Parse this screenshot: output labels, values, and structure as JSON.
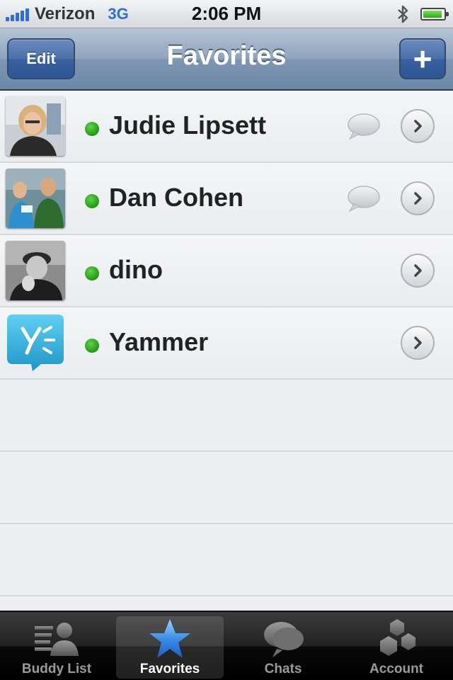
{
  "status_bar": {
    "carrier": "Verizon",
    "network": "3G",
    "time": "2:06 PM"
  },
  "nav": {
    "title": "Favorites",
    "edit_label": "Edit",
    "add_label": "+"
  },
  "contacts": [
    {
      "name": "Judie Lipsett",
      "status": "online",
      "has_chat": true
    },
    {
      "name": "Dan Cohen",
      "status": "online",
      "has_chat": true
    },
    {
      "name": "dino",
      "status": "online",
      "has_chat": false
    },
    {
      "name": "Yammer",
      "status": "online",
      "has_chat": false
    }
  ],
  "tabs": [
    {
      "label": "Buddy List",
      "icon": "buddy-list-icon",
      "selected": false
    },
    {
      "label": "Favorites",
      "icon": "star-icon",
      "selected": true
    },
    {
      "label": "Chats",
      "icon": "chat-bubbles-icon",
      "selected": false
    },
    {
      "label": "Account",
      "icon": "account-cubes-icon",
      "selected": false
    }
  ],
  "colors": {
    "nav_accent": "#6d87a8",
    "button_blue": "#3a60a0",
    "online_green": "#2eaa14",
    "signal_blue": "#2f6fd6",
    "favorites_star": "#3a8ee8"
  }
}
